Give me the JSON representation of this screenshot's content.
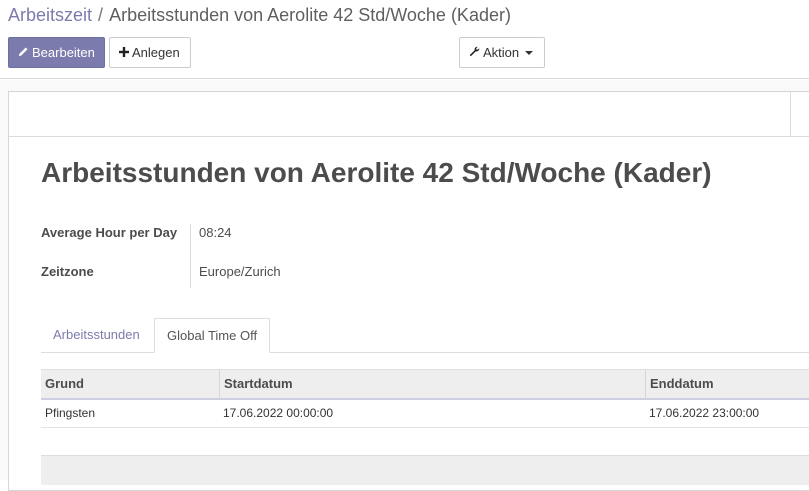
{
  "breadcrumb": {
    "parent": "Arbeitszeit",
    "separator": "/",
    "current": "Arbeitsstunden von Aerolite 42 Std/Woche (Kader)"
  },
  "toolbar": {
    "edit_label": "Bearbeiten",
    "create_label": "Anlegen",
    "action_label": "Aktion",
    "edit_icon": "pencil-icon",
    "create_icon": "plus-icon",
    "action_icon": "wrench-icon"
  },
  "record": {
    "title": "Arbeitsstunden von Aerolite 42 Std/Woche (Kader)",
    "fields": [
      {
        "label": "Average Hour per Day",
        "value": "08:24"
      },
      {
        "label": "Zeitzone",
        "value": "Europe/Zurich"
      }
    ]
  },
  "tabs": [
    {
      "label": "Arbeitsstunden",
      "active": false
    },
    {
      "label": "Global Time Off",
      "active": true
    }
  ],
  "table": {
    "columns": [
      "Grund",
      "Startdatum",
      "Enddatum"
    ],
    "rows": [
      {
        "grund": "Pfingsten",
        "start": "17.06.2022 00:00:00",
        "end": "17.06.2022 23:00:00"
      }
    ]
  },
  "colors": {
    "primary": "#7c7bad",
    "text": "#4c4c4c"
  }
}
